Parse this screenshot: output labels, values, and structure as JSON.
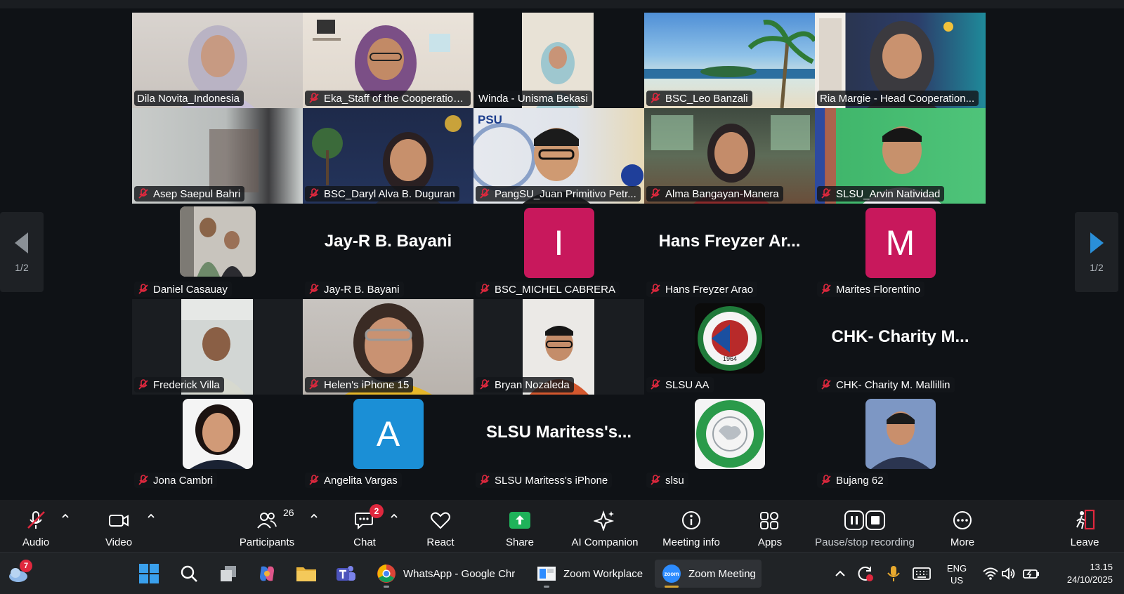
{
  "participants": [
    {
      "name": "Dila Novita_Indonesia"
    },
    {
      "name": "Eka_Staff of the Cooperation..."
    },
    {
      "name": "Winda - Unisma Bekasi"
    },
    {
      "name": "BSC_Leo Banzali"
    },
    {
      "name": "Ria Margie - Head Cooperation..."
    },
    {
      "name": "Asep Saepul Bahri"
    },
    {
      "name": "BSC_Daryl Alva B. Duguran"
    },
    {
      "name": "PangSU_Juan Primitivo Petr..."
    },
    {
      "name": "Alma Bangayan-Manera"
    },
    {
      "name": "SLSU_Arvin Natividad"
    },
    {
      "name": "Daniel Casauay"
    },
    {
      "name": "Jay-R B. Bayani",
      "display": "Jay-R B. Bayani"
    },
    {
      "name": "BSC_MICHEL CABRERA",
      "letter": "I"
    },
    {
      "name": "Hans Freyzer Arao",
      "display": "Hans Freyzer Ar..."
    },
    {
      "name": "Marites Florentino",
      "letter": "M"
    },
    {
      "name": "Frederick Villa"
    },
    {
      "name": "Helen's iPhone 15"
    },
    {
      "name": "Bryan Nozaleda"
    },
    {
      "name": "SLSU AA",
      "logo_year": "1964"
    },
    {
      "name": "CHK- Charity M. Mallillin",
      "display": "CHK- Charity M..."
    },
    {
      "name": "Jona Cambri"
    },
    {
      "name": "Angelita Vargas",
      "letter": "A"
    },
    {
      "name": "SLSU Maritess's iPhone",
      "display": "SLSU Maritess's..."
    },
    {
      "name": "slsu"
    },
    {
      "name": "Bujang 62"
    }
  ],
  "tile_text": {
    "psu_label": "PSU"
  },
  "pager": {
    "left": "1/2",
    "right": "1/2"
  },
  "toolbar": {
    "audio": "Audio",
    "video": "Video",
    "participants": "Participants",
    "participants_count": "26",
    "chat": "Chat",
    "chat_badge": "2",
    "react": "React",
    "share": "Share",
    "ai_companion": "AI Companion",
    "meeting_info": "Meeting info",
    "apps": "Apps",
    "recording": "Pause/stop recording",
    "more": "More",
    "leave": "Leave"
  },
  "colors": {
    "active_speaker": "#2fd47e",
    "share_green": "#1fb25a",
    "leave_red": "#e0283e",
    "avatar_pink": "#c8185c",
    "avatar_blue": "#1b8fd6",
    "pager_arrow": "#2a8fd8"
  },
  "taskbar": {
    "weather_badge": "7",
    "apps": [
      {
        "label": "WhatsApp - Google Chr"
      },
      {
        "label": "Zoom Workplace"
      },
      {
        "label": "Zoom Meeting"
      }
    ],
    "language": "ENG",
    "region": "US",
    "time": "13.15",
    "date": "24/10/2025",
    "zoom_icon_label": "zoom"
  }
}
